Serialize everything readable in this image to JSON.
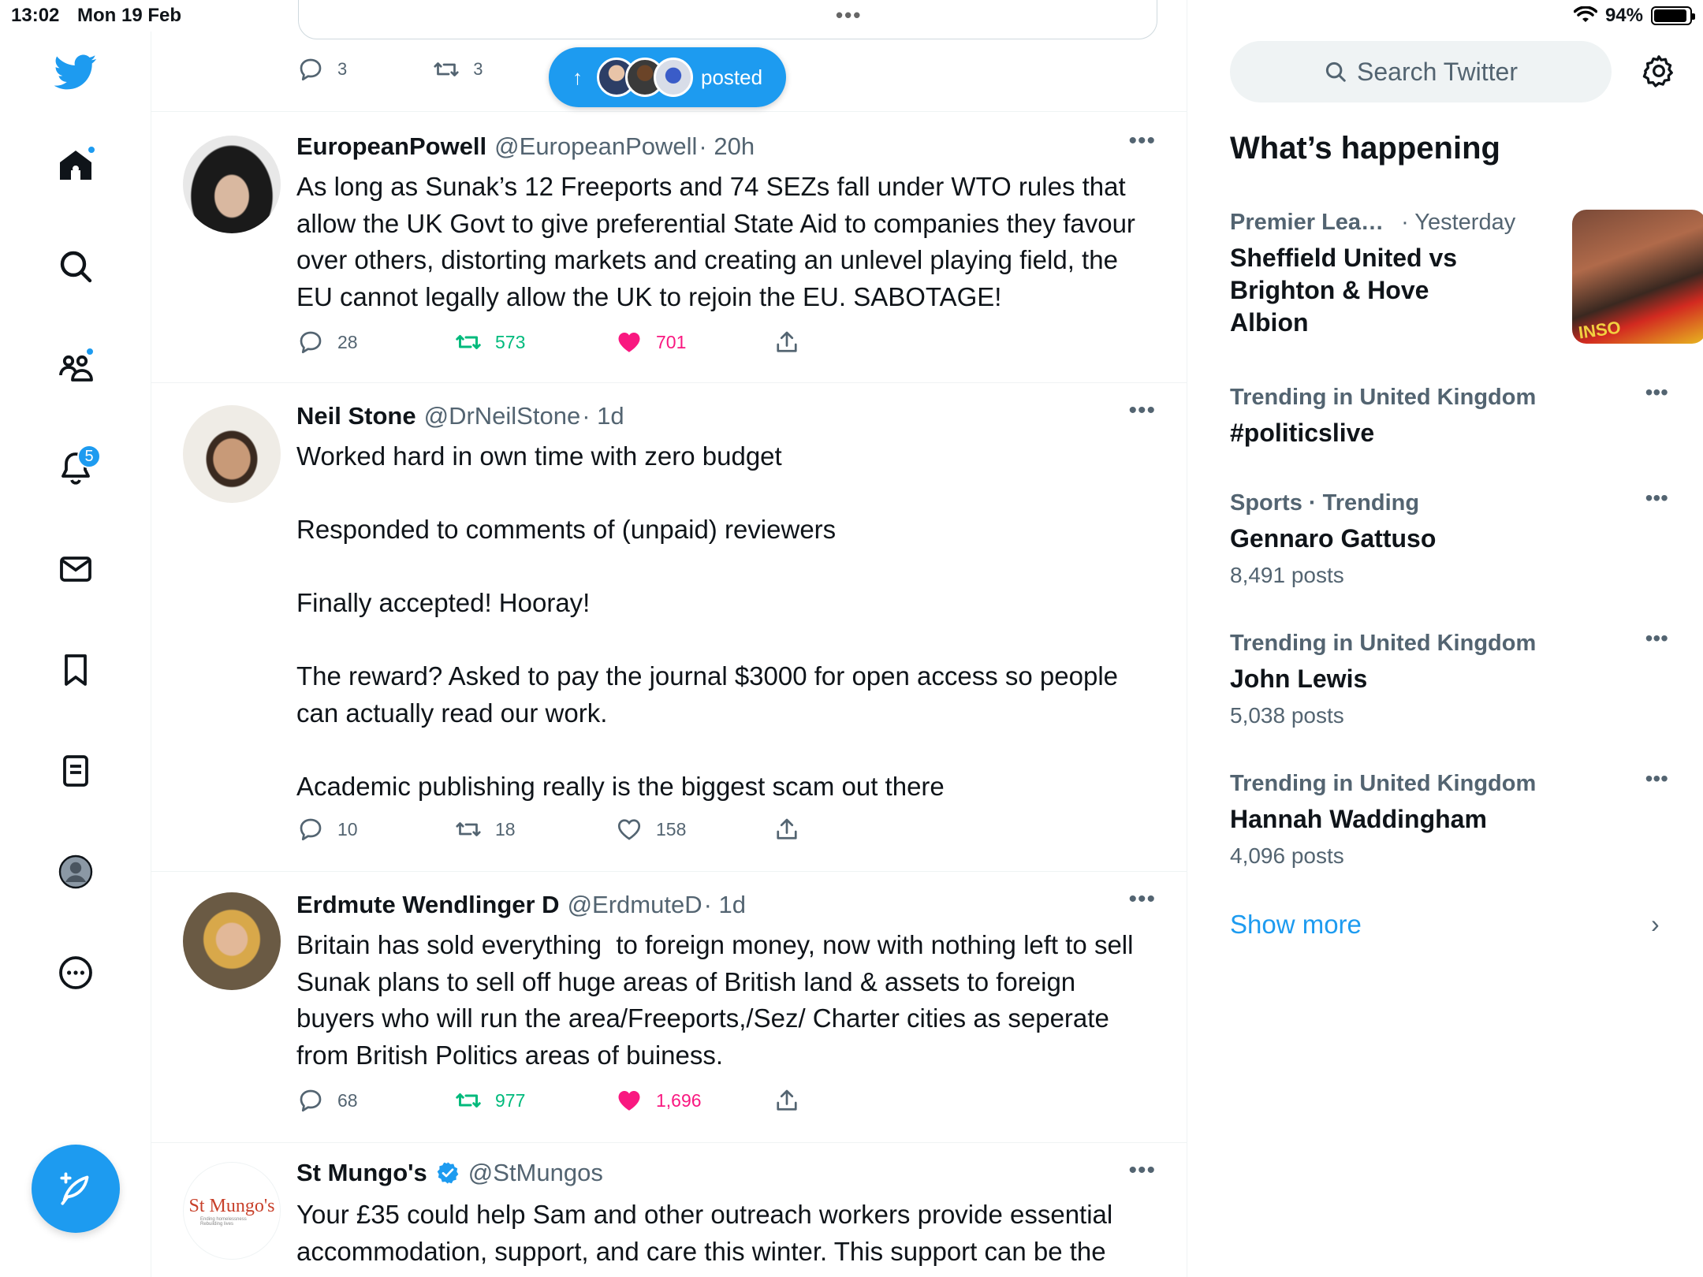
{
  "status_bar": {
    "time": "13:02",
    "date": "Mon 19 Feb",
    "battery": "94%"
  },
  "nav": {
    "notifications_badge": "5"
  },
  "top_partial": {
    "reply_count": "3",
    "retweet_count": "3",
    "new_posts_label": "posted"
  },
  "tweets": [
    {
      "name": "EuropeanPowell",
      "handle": "@EuropeanPowell",
      "time": "· 20h",
      "text": "As long as Sunak’s 12 Freeports and 74 SEZs fall under WTO rules that allow the UK Govt to give preferential State Aid to companies they favour over others, distorting markets and creating an unlevel playing field, the EU cannot legally allow the UK to rejoin the EU. SABOTAGE!",
      "replies": "28",
      "retweets": "573",
      "likes": "701"
    },
    {
      "name": "Neil Stone",
      "handle": "@DrNeilStone",
      "time": "· 1d",
      "text": "Worked hard in own time with zero budget\n\nResponded to comments of (unpaid) reviewers\n\nFinally accepted! Hooray!\n\nThe reward? Asked to pay the journal $3000 for open access so people can actually read our work.\n\nAcademic publishing really is the biggest scam out there",
      "replies": "10",
      "retweets": "18",
      "likes": "158"
    },
    {
      "name": "Erdmute Wendlinger D",
      "handle": "@ErdmuteD",
      "time": "· 1d",
      "text": "Britain has sold everything  to foreign money, now with nothing left to sell Sunak plans to sell off huge areas of British land & assets to foreign buyers who will run the area/Freeports,/Sez/ Charter cities as seperate from British Politics areas of buiness.",
      "replies": "68",
      "retweets": "977",
      "likes": "1,696"
    },
    {
      "name": "St Mungo's",
      "handle": "@StMungos",
      "time": "",
      "text": "Your £35 could help Sam and other outreach workers provide essential accommodation, support, and care this winter. This support can be the",
      "avatar_text": "St Mungo's",
      "avatar_subtext": "Ending homelessness Rebuilding lives"
    }
  ],
  "sidebar": {
    "search_placeholder": "Search Twitter",
    "whats_happening": "What’s happening",
    "trends": [
      {
        "category": "Premier Lea…",
        "meta": "· Yesterday",
        "title": "Sheffield United vs Brighton & Hove Albion",
        "count": "",
        "image_text": "INSO"
      },
      {
        "category": "Trending in United Kingdom",
        "meta": "",
        "title": "#politicslive",
        "count": ""
      },
      {
        "category": "Sports · Trending",
        "meta": "",
        "title": "Gennaro Gattuso",
        "count": "8,491 posts"
      },
      {
        "category": "Trending in United Kingdom",
        "meta": "",
        "title": "John Lewis",
        "count": "5,038 posts"
      },
      {
        "category": "Trending in United Kingdom",
        "meta": "",
        "title": "Hannah Waddingham",
        "count": "4,096 posts"
      }
    ],
    "show_more": "Show more"
  },
  "colors": {
    "accent": "#1d9bf0",
    "retweet": "#00ba7c",
    "like": "#f91880",
    "secondary_text": "#536471"
  }
}
